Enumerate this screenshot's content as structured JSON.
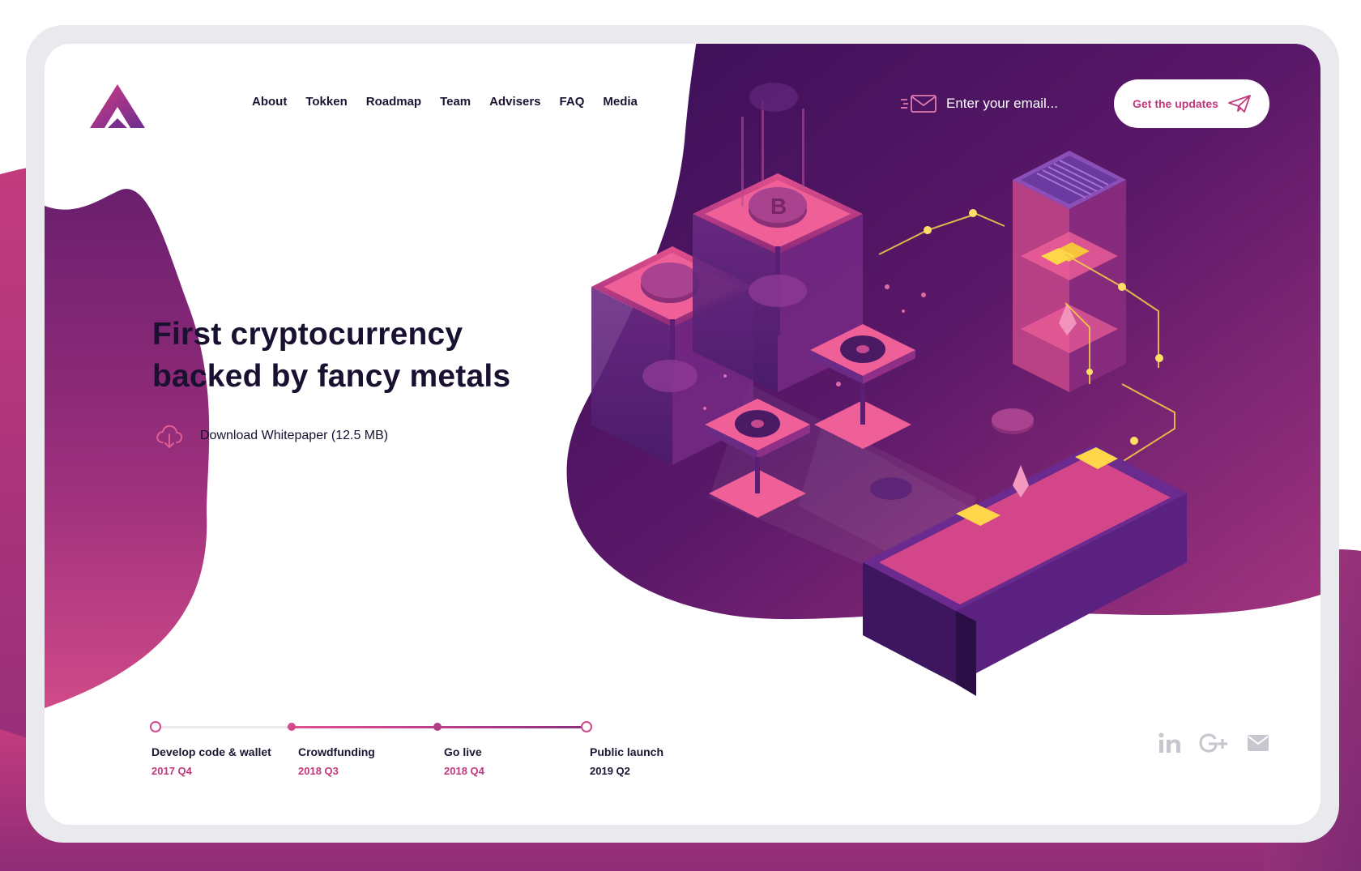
{
  "brand": {
    "name": "logo-mark"
  },
  "nav": {
    "items": [
      {
        "label": "About"
      },
      {
        "label": "Tokken"
      },
      {
        "label": "Roadmap"
      },
      {
        "label": "Team"
      },
      {
        "label": "Advisers"
      },
      {
        "label": "FAQ"
      },
      {
        "label": "Media"
      }
    ]
  },
  "subscribe": {
    "placeholder": "Enter your email...",
    "button_label": "Get the updates",
    "icon": "paper-plane-icon"
  },
  "hero": {
    "title_line1": "First cryptocurrency",
    "title_line2": "backed by fancy metals",
    "download_label": "Download Whitepaper (12.5 MB)",
    "download_icon": "cloud-download-icon"
  },
  "roadmap": {
    "progress_fraction": 1.0,
    "steps": [
      {
        "title": "Develop code & wallet",
        "date": "2017 Q4",
        "date_color": "#c2387c"
      },
      {
        "title": "Crowdfunding",
        "date": "2018 Q3",
        "date_color": "#c2387c"
      },
      {
        "title": "Go live",
        "date": "2018 Q4",
        "date_color": "#c2387c"
      },
      {
        "title": "Public launch",
        "date": "2019 Q2",
        "date_color": "#1d1433"
      }
    ]
  },
  "social": {
    "items": [
      {
        "icon": "linkedin-icon"
      },
      {
        "icon": "google-plus-icon"
      },
      {
        "icon": "mail-icon"
      }
    ]
  },
  "colors": {
    "accent": "#c2387c",
    "deep_purple": "#3d1158",
    "magenta": "#b93a7f",
    "text_dark": "#1d1433"
  }
}
